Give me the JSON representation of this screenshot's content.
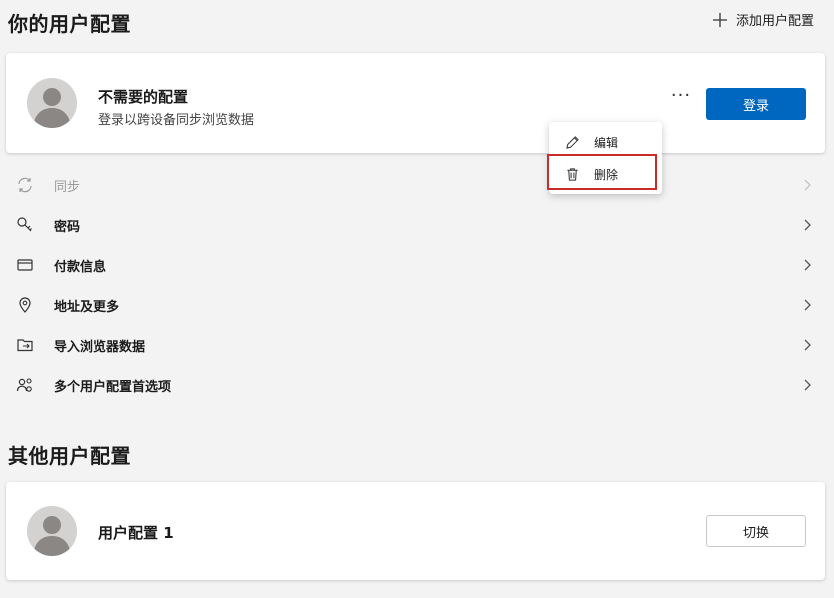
{
  "header": {
    "title": "你的用户配置",
    "add_profile": "添加用户配置"
  },
  "current_profile": {
    "name": "不需要的配置",
    "subtitle": "登录以跨设备同步浏览数据",
    "more_label": "···",
    "signin_label": "登录"
  },
  "context_menu": {
    "edit": "编辑",
    "delete": "删除"
  },
  "settings": [
    {
      "label": "同步",
      "icon": "sync-icon",
      "disabled": true
    },
    {
      "label": "密码",
      "icon": "key-icon"
    },
    {
      "label": "付款信息",
      "icon": "card-icon"
    },
    {
      "label": "地址及更多",
      "icon": "location-icon"
    },
    {
      "label": "导入浏览器数据",
      "icon": "import-icon"
    },
    {
      "label": "多个用户配置首选项",
      "icon": "people-icon"
    }
  ],
  "other": {
    "title": "其他用户配置",
    "profile_name": "用户配置 1",
    "switch_label": "切换"
  },
  "colors": {
    "accent": "#0067c0",
    "highlight": "#cc2b2b",
    "background": "#f3f3f3"
  }
}
